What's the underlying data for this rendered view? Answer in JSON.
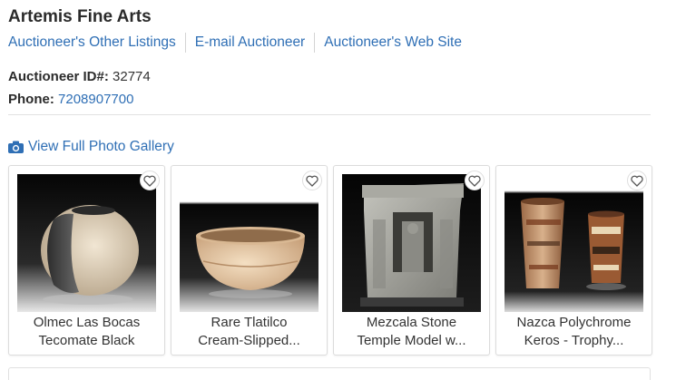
{
  "auctioneer": {
    "name": "Artemis Fine Arts",
    "links": [
      {
        "label": "Auctioneer's Other Listings"
      },
      {
        "label": "E-mail Auctioneer"
      },
      {
        "label": "Auctioneer's Web Site"
      }
    ],
    "id_label": "Auctioneer ID#:",
    "id_value": "32774",
    "phone_label": "Phone:",
    "phone_value": "7208907700"
  },
  "gallery": {
    "link_label": "View Full Photo Gallery",
    "icon": "camera-icon",
    "items": [
      {
        "line1": "Olmec Las Bocas",
        "line2": "Tecomate Black",
        "icon": "heart-icon"
      },
      {
        "line1": "Rare Tlatilco",
        "line2": "Cream-Slipped...",
        "icon": "heart-icon"
      },
      {
        "line1": "Mezcala Stone",
        "line2": "Temple Model w...",
        "icon": "heart-icon"
      },
      {
        "line1": "Nazca Polychrome",
        "line2": "Keros - Trophy...",
        "icon": "heart-icon"
      }
    ]
  },
  "colors": {
    "link": "#2f6fb5",
    "text": "#2b2b2b",
    "border": "#dcdcdc"
  }
}
